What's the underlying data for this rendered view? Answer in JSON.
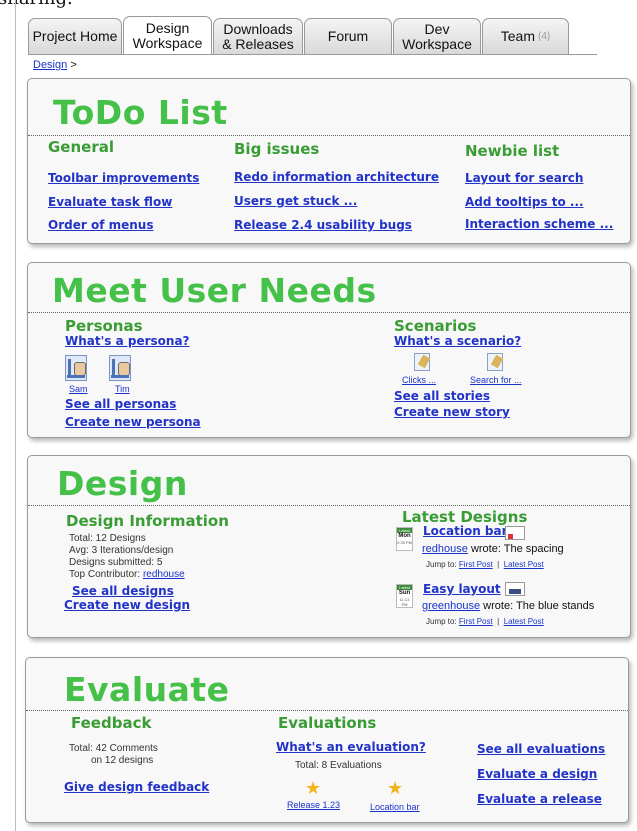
{
  "cutoff_text": "sharing.",
  "tabs": [
    {
      "label": "Project Home",
      "active": false
    },
    {
      "label": "Design Workspace",
      "active": true
    },
    {
      "label": "Downloads & Releases",
      "active": false
    },
    {
      "label": "Forum",
      "active": false
    },
    {
      "label": "Dev Workspace",
      "active": false
    },
    {
      "label": "Team",
      "count": "(4)",
      "active": false
    }
  ],
  "breadcrumb": {
    "link": "Design",
    "sep": ">"
  },
  "todo": {
    "title": "ToDo List",
    "columns": [
      {
        "heading": "General",
        "items": [
          "Toolbar improvements",
          "Evaluate task flow",
          "Order of menus"
        ]
      },
      {
        "heading": "Big issues",
        "items": [
          "Redo information architecture",
          "Users get stuck ...",
          "Release 2.4 usability bugs"
        ]
      },
      {
        "heading": "Newbie list",
        "items": [
          "Layout for search",
          "Add tooltips to ...",
          "Interaction scheme ..."
        ]
      }
    ]
  },
  "needs": {
    "title": "Meet User Needs",
    "personas_heading": "Personas",
    "whats_persona": "What's a persona?",
    "personas": [
      "Sam",
      "Tim"
    ],
    "see_all_personas": "See all personas",
    "create_persona": "Create new persona",
    "scenarios_heading": "Scenarios",
    "whats_scenario": "What's a scenario?",
    "scenarios": [
      "Clicks ...",
      "Search for ..."
    ],
    "see_all_stories": "See all stories",
    "create_story": "Create new story"
  },
  "design": {
    "title": "Design",
    "info_heading": "Design Information",
    "total": "Total: 12 Designs",
    "avg": "Avg: 3 Iterations/design",
    "submitted": "Designs submitted: 5",
    "top_contributor_label": "Top Contributor:",
    "top_contributor": "redhouse",
    "see_all": "See all designs",
    "create_new": "Create new design",
    "latest_heading": "Latest Designs",
    "latest": [
      {
        "title": "Location bar",
        "cal_day": "Mon",
        "cal_time": "2:35 PM",
        "cal_posts": "2 Posts",
        "user": "redhouse",
        "wrote": "wrote: The spacing"
      },
      {
        "title": "Easy layout",
        "cal_day": "Sun",
        "cal_time": "11:13 PM",
        "cal_posts": "3 Posts",
        "user": "greenhouse",
        "wrote": "wrote: The blue stands"
      }
    ],
    "jump_to": "Jump to:",
    "first_post": "First Post",
    "pipe": "|",
    "latest_post": "Latest Post"
  },
  "evaluate": {
    "title": "Evaluate",
    "feedback_heading": "Feedback",
    "feedback_total": "Total: 42 Comments",
    "feedback_on": "on 12 designs",
    "give_feedback": "Give design feedback",
    "evaluations_heading": "Evaluations",
    "whats_evaluation": "What's an evaluation?",
    "eval_total": "Total: 8 Evaluations",
    "eval_items": [
      "Release 1.23",
      "Location bar"
    ],
    "see_all": "See all evaluations",
    "evaluate_design": "Evaluate a design",
    "evaluate_release": "Evaluate a release"
  },
  "colors": {
    "title_green": "#45c048",
    "heading_green": "#3a9c34",
    "link_blue": "#2233c8"
  }
}
